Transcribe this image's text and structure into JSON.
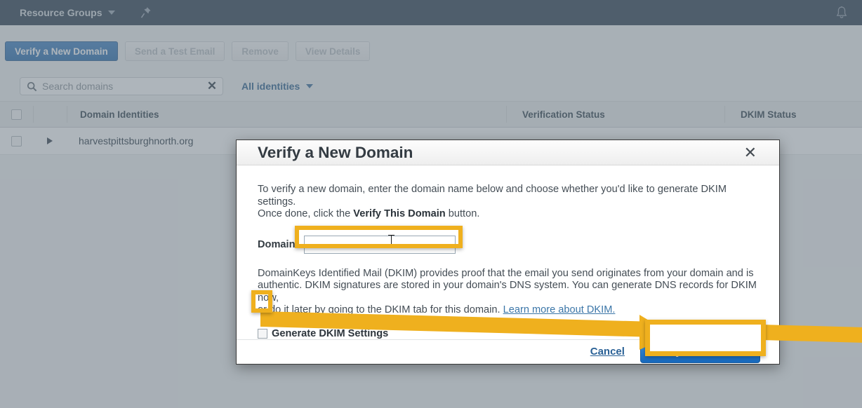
{
  "topbar": {
    "resource_groups_label": "Resource Groups",
    "chevron_icon": "chevron-down-icon",
    "pin_icon": "pin-icon",
    "bell_icon": "bell-icon"
  },
  "actionbar": {
    "buttons": [
      {
        "label": "Verify a New Domain",
        "state": "enabled"
      },
      {
        "label": "Send a Test Email",
        "state": "disabled"
      },
      {
        "label": "Remove",
        "state": "disabled"
      },
      {
        "label": "View Details",
        "state": "disabled"
      }
    ]
  },
  "toolbar": {
    "search_placeholder": "Search domains",
    "search_value": "",
    "search_icon": "search-icon",
    "clear_icon": "close-icon",
    "filter_label": "All identities",
    "filter_chevron": "chevron-down-icon"
  },
  "table": {
    "columns": [
      "Domain Identities",
      "Verification Status",
      "DKIM Status"
    ],
    "rows": [
      {
        "domain": "harvestpittsburghnorth.org",
        "verification_status": "",
        "dkim_status": ""
      }
    ]
  },
  "modal": {
    "title": "Verify a New Domain",
    "close_icon": "close-icon",
    "intro_line1": "To verify a new domain, enter the domain name below and choose whether you'd like to generate DKIM settings.",
    "intro_line2_pre": "Once done, click the ",
    "intro_line2_bold": "Verify This Domain",
    "intro_line2_post": " button.",
    "domain_label": "Domain:",
    "domain_value": "",
    "dkim_para_line1": "DomainKeys Identified Mail (DKIM) provides proof that the email you send originates from your domain and is",
    "dkim_para_line2": "authentic. DKIM signatures are stored in your domain's DNS system. You can generate DNS records for DKIM now,",
    "dkim_para_line3": "or do it later by going to the DKIM tab for this domain.",
    "dkim_link": "Learn more about DKIM.",
    "checkbox_label": "Generate DKIM Settings",
    "checkbox_checked": false,
    "cancel_label": "Cancel",
    "submit_label": "Verify This Domain"
  },
  "annotations": {
    "highlight_color": "#efb01e",
    "targets": [
      "domain-input",
      "generate-dkim-checkbox",
      "verify-this-domain-button"
    ],
    "arrow": "from generate-dkim-checkbox to verify-this-domain-button"
  }
}
